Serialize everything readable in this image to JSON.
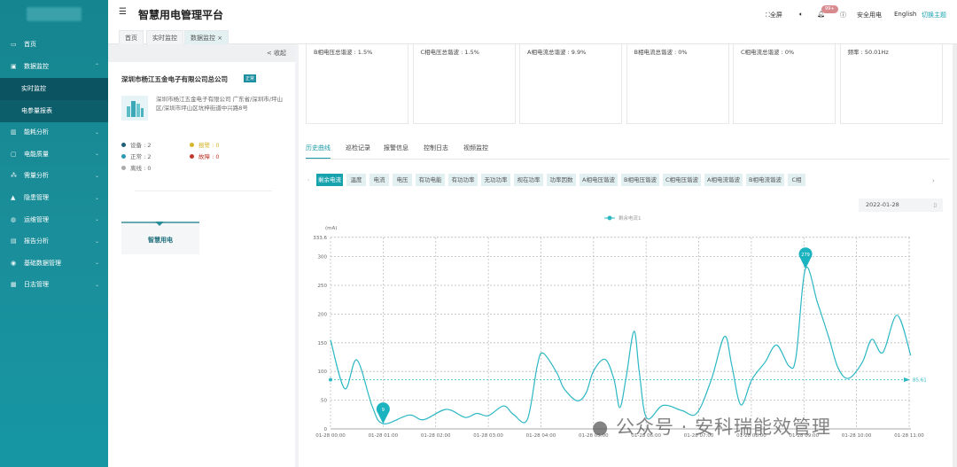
{
  "app": {
    "title": "智慧用电管理平台"
  },
  "header": {
    "fullscreen": "全屏",
    "notifications_badge": "99+",
    "safety": "安全用电",
    "language": "English",
    "theme": "切换主题"
  },
  "tabs": [
    {
      "label": "首页"
    },
    {
      "label": "实时监控"
    },
    {
      "label": "数据监控"
    }
  ],
  "sidebar": {
    "items": [
      {
        "label": "首页",
        "icon": "monitor-icon"
      },
      {
        "label": "数据监控",
        "icon": "data-icon",
        "expanded": true,
        "children": [
          {
            "label": "实时监控",
            "active": true
          },
          {
            "label": "电参量报表"
          }
        ]
      },
      {
        "label": "能耗分析",
        "icon": "bar-chart-icon"
      },
      {
        "label": "电能质量",
        "icon": "calendar-icon"
      },
      {
        "label": "需量分析",
        "icon": "nodes-icon"
      },
      {
        "label": "隐患管理",
        "icon": "warning-icon"
      },
      {
        "label": "运维管理",
        "icon": "globe-icon"
      },
      {
        "label": "报告分析",
        "icon": "report-icon"
      },
      {
        "label": "基础数据管理",
        "icon": "database-icon"
      },
      {
        "label": "日志管理",
        "icon": "log-icon"
      }
    ]
  },
  "left_panel": {
    "collapse": "< 收起",
    "company": "深圳市杨江五金电子有限公司总公司",
    "status": "正常",
    "address": "深圳市杨江五金电子有限公司 广东省/深圳市/坪山区/深圳市坪山区坑梓街道中兴路8号",
    "stats": [
      {
        "label": "设备 : 2",
        "color": "#1f5f7a"
      },
      {
        "label": "报警 : 0",
        "color": "#d4b52a"
      },
      {
        "label": "正常 : 2",
        "color": "#2a9ab0"
      },
      {
        "label": "故障 : 0",
        "color": "#c0392b"
      },
      {
        "label": "离线 : 0",
        "color": "#aaaaaa"
      }
    ],
    "smart_button": "智慧用电"
  },
  "cards": [
    "B相电压总谐波 : 1.5%",
    "C相电压总谐波 : 1.5%",
    "A相电流总谐波 : 9.9%",
    "B相电流总谐波 : 0%",
    "C相电流总谐波 : 0%",
    "频率 : 50.01Hz"
  ],
  "subtabs": [
    "历史曲线",
    "巡检记录",
    "报警信息",
    "控制日志",
    "视频监控"
  ],
  "metrics": [
    "剩余电流",
    "温度",
    "电流",
    "电压",
    "有功电能",
    "有功功率",
    "无功功率",
    "视在功率",
    "功率因数",
    "A相电压谐波",
    "B相电压谐波",
    "C相电压谐波",
    "A相电流谐波",
    "B相电流谐波",
    "C相"
  ],
  "date": "2022-01-28",
  "watermark": "公众号 · 安科瑞能效管理",
  "chart_data": {
    "type": "line",
    "title": "",
    "legend": [
      "剩余电流1"
    ],
    "legend_position": "top-center",
    "ylabel": "(mA)",
    "ylim": [
      0,
      333.6
    ],
    "yticks": [
      0,
      50,
      100,
      150,
      200,
      250,
      300,
      333.6
    ],
    "xlim_hours": [
      0,
      11
    ],
    "xticks": [
      "01-28 00:00",
      "01-28 01:00",
      "01-28 02:00",
      "01-28 03:00",
      "01-28 04:00",
      "01-28 05:00",
      "01-28 06:00",
      "01-28 07:00",
      "01-28 08:00",
      "01-28 09:00",
      "01-28 10:00",
      "01-28 11:00"
    ],
    "grid": true,
    "color": "#2bb7c4",
    "series": [
      {
        "name": "剩余电流1",
        "x": [
          0,
          0.27,
          0.5,
          0.79,
          1.0,
          1.49,
          1.77,
          2.2,
          2.56,
          2.78,
          3.0,
          3.29,
          3.48,
          3.74,
          3.93,
          4.04,
          4.3,
          4.44,
          4.69,
          4.86,
          5.0,
          5.22,
          5.39,
          5.5,
          5.62,
          5.77,
          5.87,
          6.01,
          6.32,
          6.68,
          6.96,
          7.24,
          7.49,
          7.63,
          7.8,
          8.01,
          8.26,
          8.48,
          8.72,
          8.85,
          9.03,
          9.26,
          9.48,
          9.65,
          9.85,
          10.11,
          10.29,
          10.5,
          10.77,
          11.03
        ],
        "y": [
          155,
          70,
          120,
          40,
          9,
          24,
          16,
          34,
          20,
          27,
          23,
          40,
          25,
          16,
          110,
          132,
          98,
          70,
          49,
          63,
          101,
          121,
          86,
          37,
          90,
          170,
          99,
          19,
          41,
          32,
          27,
          86,
          161,
          110,
          42,
          86,
          116,
          146,
          109,
          126,
          279,
          219,
          157,
          106,
          88,
          116,
          156,
          133,
          198,
          128
        ]
      }
    ],
    "mark_points": [
      {
        "label": "9",
        "x": 1.0,
        "y": 9
      },
      {
        "label": "279",
        "x": 9.03,
        "y": 279
      }
    ],
    "mark_line": {
      "label": "85.61",
      "y": 85.61
    }
  }
}
